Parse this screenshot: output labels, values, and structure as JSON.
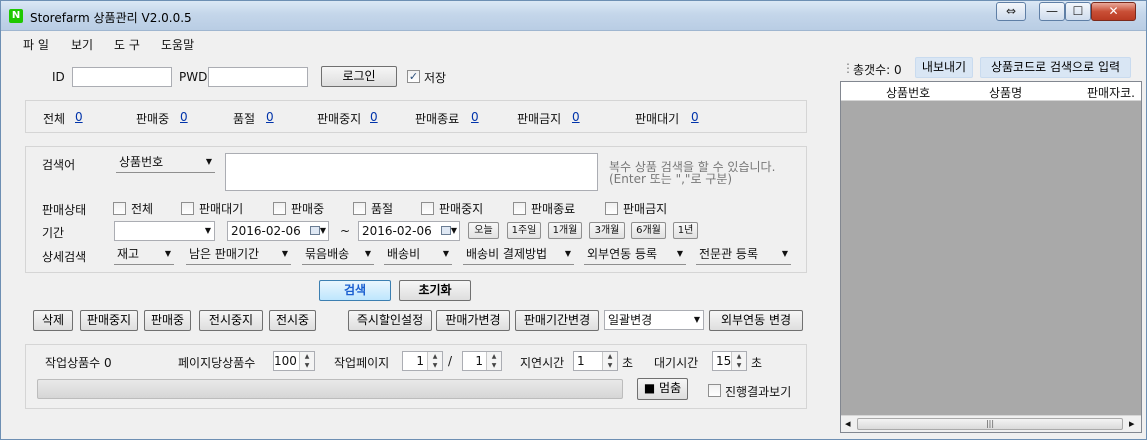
{
  "window": {
    "app_icon": "N",
    "title": "Storefarm 상품관리 V2.0.0.5",
    "restore_glyph": "⇔",
    "min_glyph": "—",
    "max_glyph": "☐",
    "close_glyph": "✕"
  },
  "menu": [
    "파 일",
    "보기",
    "도 구",
    "도움말"
  ],
  "login": {
    "id_label": "ID",
    "pwd_label": "PWD",
    "id_value": "",
    "pwd_value": "",
    "login_button": "로그인",
    "save_label": "저장",
    "save_checked": true
  },
  "summary": [
    {
      "label": "전체",
      "count": "0"
    },
    {
      "label": "판매중",
      "count": "0"
    },
    {
      "label": "품절",
      "count": "0"
    },
    {
      "label": "판매중지",
      "count": "0"
    },
    {
      "label": "판매종료",
      "count": "0"
    },
    {
      "label": "판매금지",
      "count": "0"
    },
    {
      "label": "판매대기",
      "count": "0"
    }
  ],
  "search": {
    "keyword_label": "검색어",
    "keyword_type": "상품번호",
    "keyword_text": "",
    "hint_line1": "복수 상품 검색을 할 수 있습니다.",
    "hint_line2": "(Enter 또는 \",\"로 구분)",
    "status_label": "판매상태",
    "status_options": [
      "전체",
      "판매대기",
      "판매중",
      "품절",
      "판매중지",
      "판매종료",
      "판매금지"
    ],
    "period_label": "기간",
    "period_type": "",
    "date_from": "2016-02-06",
    "tilde": "~",
    "date_to": "2016-02-06",
    "period_buttons": [
      "오늘",
      "1주일",
      "1개월",
      "3개월",
      "6개월",
      "1년"
    ],
    "detail_label": "상세검색",
    "detail_filters": [
      "재고",
      "남은 판매기간",
      "묶음배송",
      "배송비",
      "배송비 결제방법",
      "외부연동 등록",
      "전문관 등록"
    ]
  },
  "actions": {
    "search_button": "검색",
    "reset_button": "초기화",
    "delete": "삭제",
    "stop_sale": "판매중지",
    "on_sale": "판매중",
    "stop_display": "전시중지",
    "display": "전시중",
    "instant_discount": "즉시할인설정",
    "change_price": "판매가변경",
    "change_period": "판매기간변경",
    "bulk_change": "일괄변경",
    "external_link_change": "외부연동 변경"
  },
  "job": {
    "work_count_label": "작업상품수 0",
    "per_page_label": "페이지당상품수",
    "per_page_value": "100",
    "work_page_label": "작업페이지",
    "page_current": "1",
    "page_sep": "/",
    "page_total": "1",
    "delay_label": "지연시간",
    "delay_value": "1",
    "delay_unit": "초",
    "wait_label": "대기시간",
    "wait_value": "15",
    "wait_unit": "초",
    "stop_button": "■ 멈춤",
    "show_progress_label": "진행결과보기",
    "progress": 0
  },
  "right": {
    "total_label": "총갯수: 0",
    "export_button": "내보내기",
    "search_by_code": "상품코드로 검색으로 입력",
    "columns": [
      "상품번호",
      "상품명",
      "판매자코."
    ],
    "scroll_thumb": "|||",
    "scroll_left": "◂",
    "scroll_right": "▸"
  }
}
